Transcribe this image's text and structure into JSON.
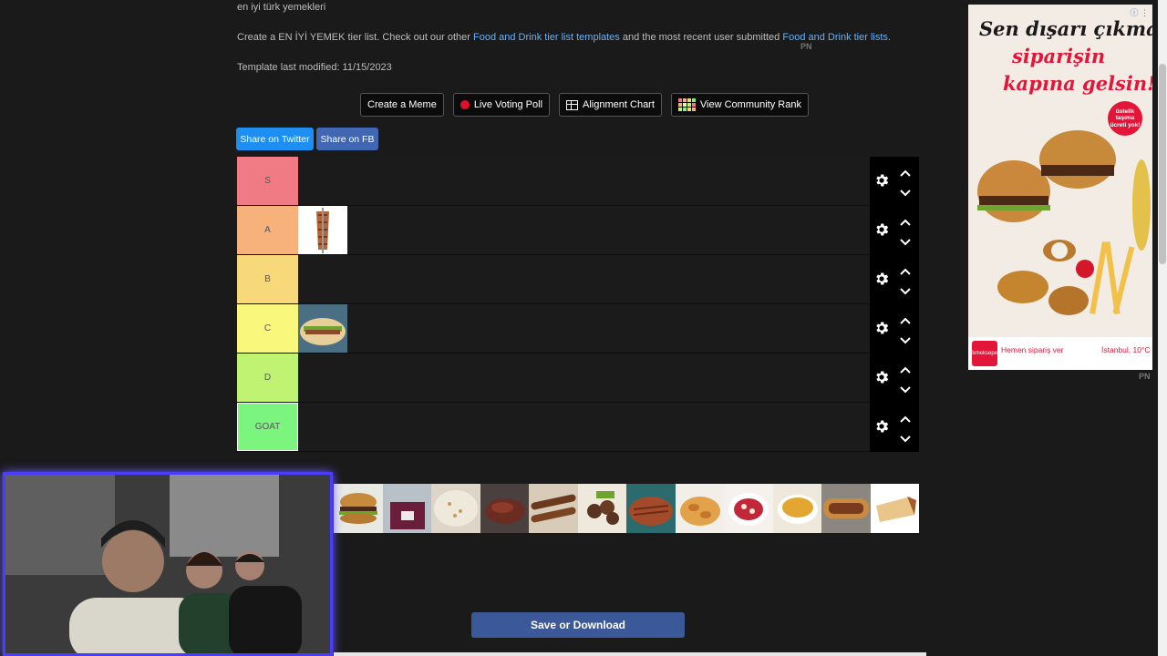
{
  "header": {
    "subtitle": "en iyi türk yemekleri",
    "desc_prefix": "Create a EN İYİ YEMEK tier list. Check out our other ",
    "desc_link1": "Food and Drink tier list templates",
    "desc_middle": " and the most recent user submitted ",
    "desc_link2": "Food and Drink tier lists",
    "desc_suffix": ".",
    "modified": "Template last modified:  11/15/2023",
    "pn": "PN"
  },
  "toolbar": {
    "create_meme": "Create a Meme",
    "live_poll": "Live Voting Poll",
    "alignment": "Alignment Chart",
    "community": "View Community Rank"
  },
  "share": {
    "twitter": "Share on Twitter",
    "fb": "Share on FB"
  },
  "tiers": [
    {
      "label": "S",
      "color": "#f07b84"
    },
    {
      "label": "A",
      "color": "#f7b27c"
    },
    {
      "label": "B",
      "color": "#f8d97a"
    },
    {
      "label": "C",
      "color": "#f9f77c"
    },
    {
      "label": "D",
      "color": "#c1f372"
    },
    {
      "label": "GOAT",
      "color": "#7cf57f"
    }
  ],
  "save_button": "Save or Download",
  "ad": {
    "line1": "Sen dışarı çıkma,",
    "line2": "siparişin",
    "line3": "kapına gelsin!",
    "badge": "üstelik taşıma ücreti yok!",
    "cta": "Hemen sipariş ver",
    "city": "İstanbul, 10°C",
    "logo": "Yemeksepeti",
    "pn": "PN"
  },
  "colors": {
    "accent": "#6ab0f3",
    "twitter": "#1d8ff2",
    "facebook": "#4267b2",
    "save": "#3b5998"
  }
}
